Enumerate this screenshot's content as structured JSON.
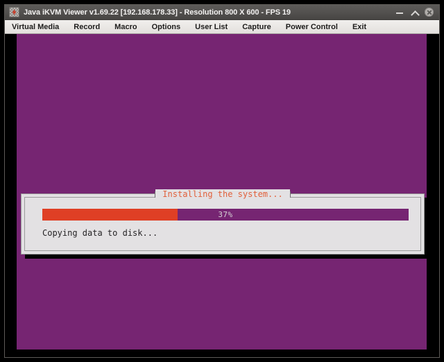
{
  "window": {
    "title": "Java iKVM Viewer v1.69.22 [192.168.178.33] - Resolution 800 X 600 - FPS 19",
    "icon": "kvm-app-icon",
    "controls": {
      "minimize": "minimize-icon",
      "maximize": "maximize-icon",
      "close": "close-icon"
    }
  },
  "menu": {
    "items": [
      {
        "label": "Virtual Media"
      },
      {
        "label": "Record"
      },
      {
        "label": "Macro"
      },
      {
        "label": "Options"
      },
      {
        "label": "User List"
      },
      {
        "label": "Capture"
      },
      {
        "label": "Power Control"
      },
      {
        "label": "Exit"
      }
    ]
  },
  "remote_screen": {
    "background_color": "#762572",
    "dialog": {
      "title": "Installing the system...",
      "title_color": "#e2613b",
      "progress": {
        "percent_label": "37%",
        "percent_value": 37,
        "fill_color": "#df3f25",
        "track_color": "#762572",
        "label_color": "#d5d2d5"
      },
      "status": "Copying data to disk..."
    }
  }
}
